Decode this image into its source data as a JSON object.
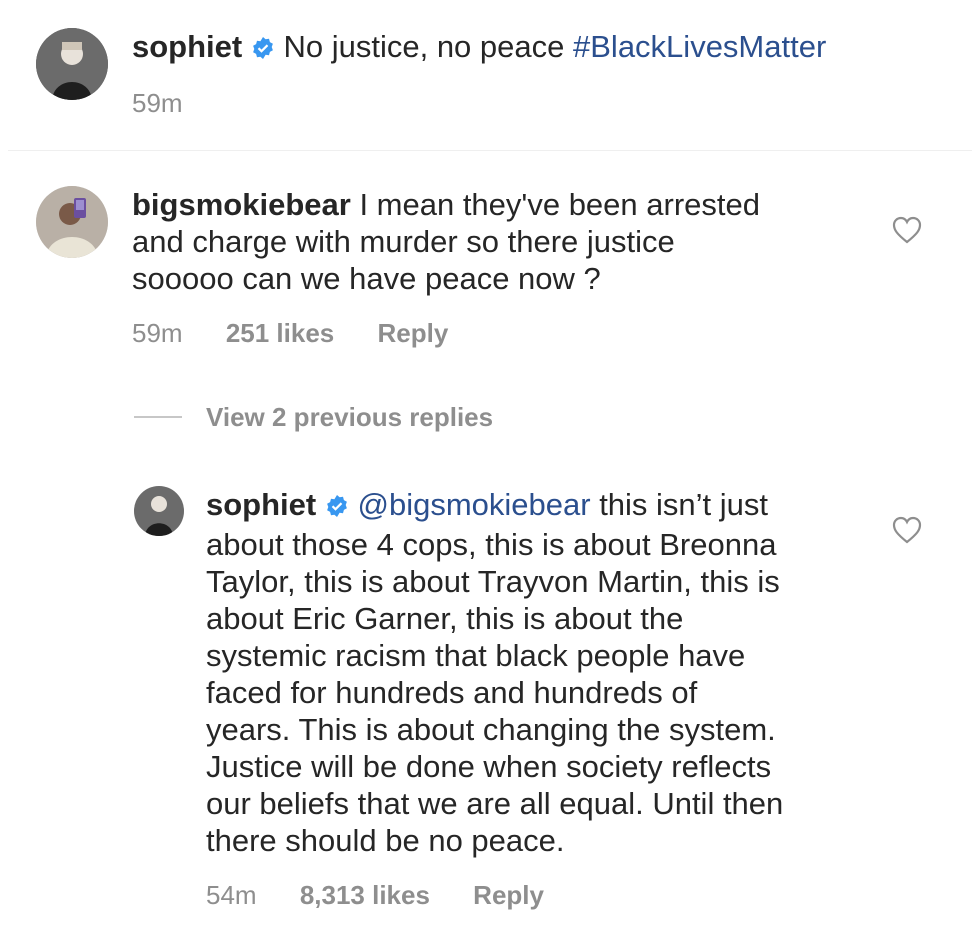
{
  "caption": {
    "username": "sophiet",
    "text": "No justice, no peace",
    "hashtag": "#BlackLivesMatter",
    "time": "59m"
  },
  "comment1": {
    "username": "bigsmokiebear",
    "text_line1": "I mean they've been arrested",
    "text_line2": "and charge with murder so there justice",
    "text_line3": "sooooo can we have peace now ?",
    "time": "59m",
    "likes": "251 likes",
    "reply_label": "Reply"
  },
  "view_replies": {
    "label": "View 2 previous replies"
  },
  "reply1": {
    "username": "sophiet",
    "mention": "@bigsmokiebear",
    "line1": "this isn’t just",
    "line2": "about those 4 cops, this is about Breonna",
    "line3": "Taylor, this is about Trayvon Martin, this is",
    "line4": "about Eric Garner, this is about the",
    "line5": "systemic racism that black people have",
    "line6": "faced for hundreds and hundreds of",
    "line7": "years. This is about changing the system.",
    "line8": "Justice will be done when society reflects",
    "line9": "our beliefs that we are all equal. Until then",
    "line10": "there should be no peace.",
    "time": "54m",
    "likes": "8,313 likes",
    "reply_label": "Reply"
  },
  "icons": {
    "verified": "verified-badge-icon",
    "like": "heart-icon"
  },
  "colors": {
    "link": "#2b4f8e",
    "secondary": "#8e8e8e",
    "verified": "#3897f0"
  }
}
